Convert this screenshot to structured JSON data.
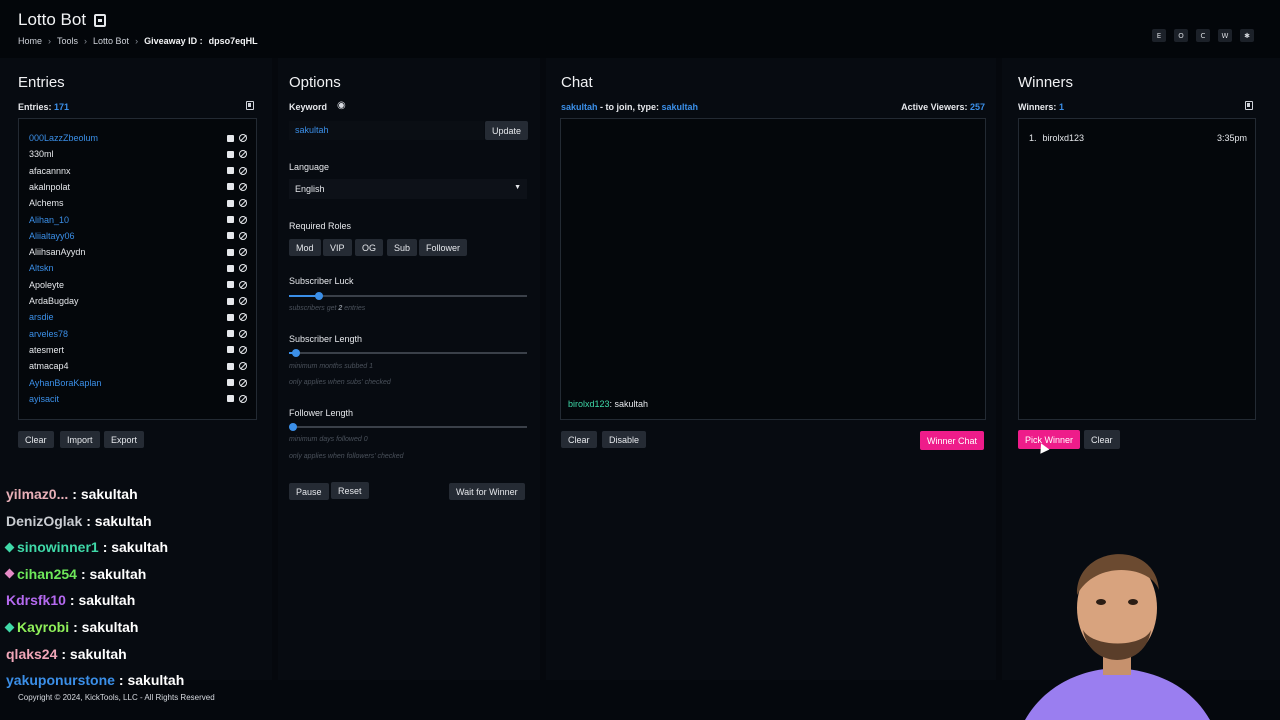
{
  "header": {
    "title": "Lotto Bot",
    "breadcrumb": [
      "Home",
      "Tools",
      "Lotto Bot"
    ],
    "giveaway_label": "Giveaway ID :",
    "giveaway_id": "dpso7eqHL",
    "corner_buttons": [
      "E",
      "O",
      "C",
      "W",
      "✱"
    ]
  },
  "entries": {
    "title": "Entries",
    "count_label": "Entries:",
    "count": "171",
    "list": [
      {
        "name": "000LazzZbeolum",
        "color": "#3b8fe8"
      },
      {
        "name": "330ml",
        "color": "#e6e8ec"
      },
      {
        "name": "afacannnx",
        "color": "#e6e8ec"
      },
      {
        "name": "akalnpolat",
        "color": "#e6e8ec"
      },
      {
        "name": "Alchems",
        "color": "#e6e8ec"
      },
      {
        "name": "Alihan_10",
        "color": "#3b8fe8"
      },
      {
        "name": "Aliialtayy06",
        "color": "#3b8fe8"
      },
      {
        "name": "AliihsanAyydn",
        "color": "#e6e8ec"
      },
      {
        "name": "Altskn",
        "color": "#3b8fe8"
      },
      {
        "name": "Apoleyte",
        "color": "#e6e8ec"
      },
      {
        "name": "ArdaBugday",
        "color": "#e6e8ec"
      },
      {
        "name": "arsdie",
        "color": "#3b8fe8"
      },
      {
        "name": "arveles78",
        "color": "#3b8fe8"
      },
      {
        "name": "atesmert",
        "color": "#e6e8ec"
      },
      {
        "name": "atmacap4",
        "color": "#e6e8ec"
      },
      {
        "name": "AyhanBoraKaplan",
        "color": "#3b8fe8"
      },
      {
        "name": "ayisacit",
        "color": "#3b8fe8"
      }
    ],
    "buttons": {
      "clear": "Clear",
      "import": "Import",
      "export": "Export"
    }
  },
  "options": {
    "title": "Options",
    "keyword_label": "Keyword",
    "keyword_value": "sakultah",
    "update": "Update",
    "language_label": "Language",
    "language_value": "English",
    "roles_label": "Required Roles",
    "roles": [
      "Mod",
      "VIP",
      "OG",
      "Sub",
      "Follower"
    ],
    "sub_luck_label": "Subscriber Luck",
    "sub_luck_hint_pre": "subscribers get ",
    "sub_luck_value": "2",
    "sub_luck_hint_post": " entries",
    "sub_luck_fraction": 0.125,
    "sub_length_label": "Subscriber Length",
    "sub_length_hint": "minimum months subbed 1",
    "sub_length_hint2": "only applies when subs' checked",
    "sub_length_fraction": 0.03,
    "follower_length_label": "Follower Length",
    "follower_length_hint": "minimum days followed 0",
    "follower_length_hint2": "only applies when followers' checked",
    "follower_length_fraction": 0.0,
    "pause": "Pause",
    "reset": "Reset",
    "wait": "Wait for Winner"
  },
  "chat": {
    "title": "Chat",
    "join_user": "sakultah",
    "join_text": " - to join, type: ",
    "join_keyword": "sakultah",
    "viewers_label": "Active Viewers:",
    "viewers": "257",
    "message_user": "birolxd123",
    "message_text": ": sakultah",
    "clear": "Clear",
    "disable": "Disable",
    "winner_chat": "Winner Chat"
  },
  "winners": {
    "title": "Winners",
    "count_label": "Winners:",
    "count": "1",
    "list": [
      {
        "rank": "1.",
        "name": "birolxd123",
        "time": "3:35pm"
      }
    ],
    "pick": "Pick Winner",
    "clear": "Clear"
  },
  "stream_chat": [
    {
      "user": "yilmaz0...",
      "msg": ": sakultah",
      "color": "#e8b0b8",
      "badge": ""
    },
    {
      "user": "DenizOglak",
      "msg": ": sakultah",
      "color": "#c9ccd1",
      "badge": ""
    },
    {
      "user": "sinowinner1",
      "msg": ": sakultah",
      "color": "#3fd9a8",
      "badge": "#3fd9a8"
    },
    {
      "user": "cihan254",
      "msg": ": sakultah",
      "color": "#6ee85a",
      "badge": "#e58ac6"
    },
    {
      "user": "Kdrsfk10",
      "msg": ": sakultah",
      "color": "#b56af0",
      "badge": ""
    },
    {
      "user": "Kayrobi",
      "msg": ": sakultah",
      "color": "#8ff05a",
      "badge": "#3fd9a8"
    },
    {
      "user": "qlaks24",
      "msg": ": sakultah",
      "color": "#f0a6b8",
      "badge": ""
    },
    {
      "user": "yakuponurstone",
      "msg": ": sakultah",
      "color": "#3b8fe8",
      "badge": ""
    }
  ],
  "footer": "Copyright © 2024, KickTools, LLC - All Rights Reserved",
  "colors": {
    "accent": "#3b8fe8",
    "pink": "#ee1c8a",
    "bg": "#05080d"
  }
}
